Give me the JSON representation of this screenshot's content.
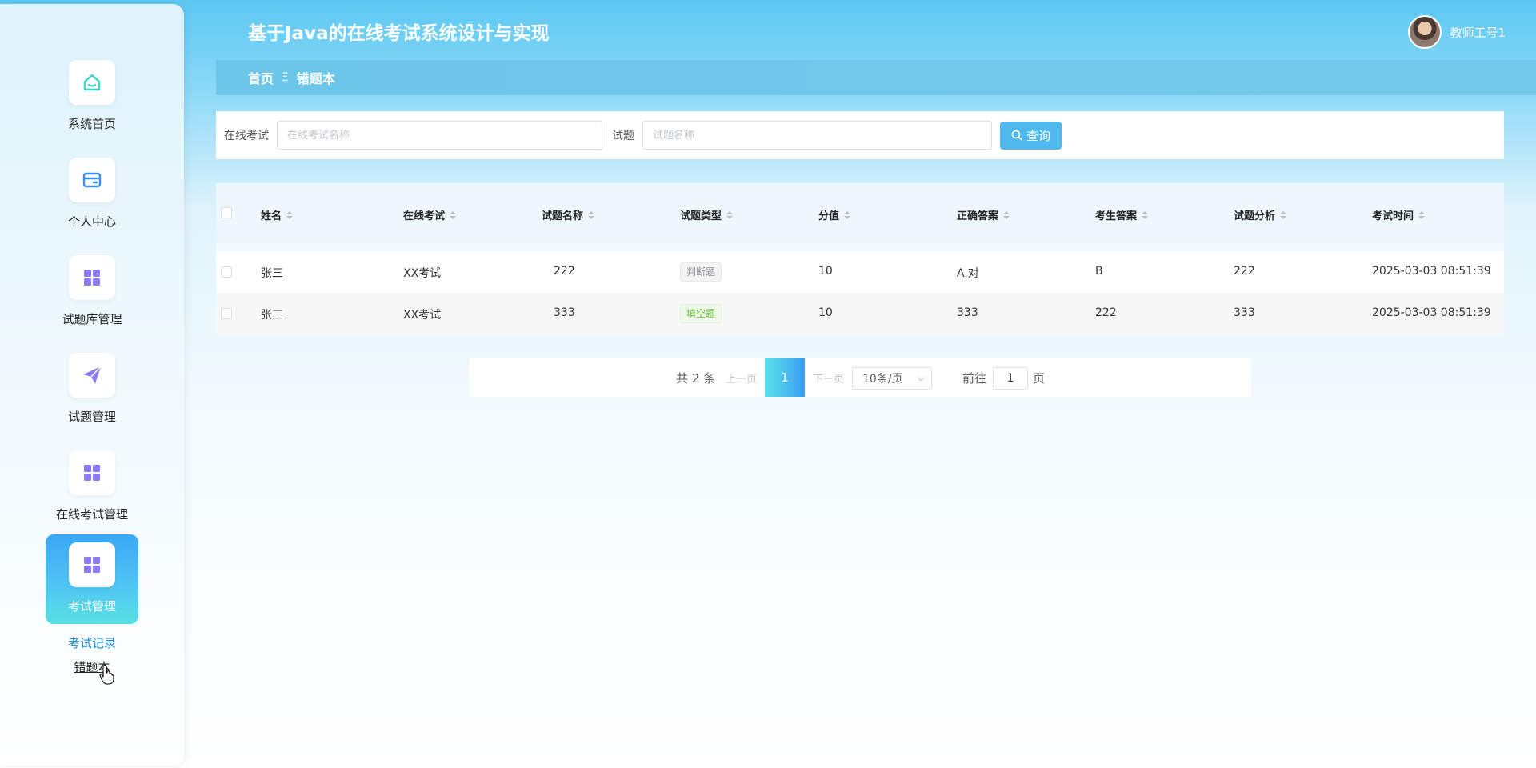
{
  "app": {
    "title": "基于Java的在线考试系统设计与实现"
  },
  "user": {
    "name": "教师工号1"
  },
  "sidebar": {
    "items": [
      {
        "label": "系统首页",
        "icon": "home-icon"
      },
      {
        "label": "个人中心",
        "icon": "wallet-card-icon"
      },
      {
        "label": "试题库管理",
        "icon": "grid-icon"
      },
      {
        "label": "试题管理",
        "icon": "paper-plane-icon"
      },
      {
        "label": "在线考试管理",
        "icon": "grid-icon"
      },
      {
        "label": "考试管理",
        "icon": "grid-icon",
        "active": true
      }
    ],
    "submenu": [
      {
        "label": "考试记录"
      },
      {
        "label": "错题本"
      }
    ]
  },
  "breadcrumb": {
    "home": "首页",
    "separator": "Ξ",
    "current": "错题本"
  },
  "search": {
    "exam_label": "在线考试",
    "exam_placeholder": "在线考试名称",
    "question_label": "试题",
    "question_placeholder": "试题名称",
    "button_label": "查询"
  },
  "table": {
    "columns": [
      "姓名",
      "在线考试",
      "试题名称",
      "试题类型",
      "分值",
      "正确答案",
      "考生答案",
      "试题分析",
      "考试时间"
    ],
    "rows": [
      {
        "name": "张三",
        "exam": "XX考试",
        "question": "222",
        "type": "判断题",
        "score": "10",
        "correct": "A.对",
        "answer": "B",
        "analysis": "222",
        "time": "2025-03-03 08:51:39"
      },
      {
        "name": "张三",
        "exam": "XX考试",
        "question": "333",
        "type": "填空题",
        "score": "10",
        "correct": "333",
        "answer": "222",
        "analysis": "333",
        "time": "2025-03-03 08:51:39"
      }
    ]
  },
  "pagination": {
    "total": "共 2 条",
    "prev": "上一页",
    "current": "1",
    "next": "下一页",
    "page_size": "10条/页",
    "goto_label": "前往",
    "goto_value": "1",
    "goto_unit": "页"
  },
  "colors": {
    "accent": "#4fb9ee",
    "active_gradient_start": "#3aa8f5",
    "active_gradient_end": "#57e0e2",
    "icon_home": "#3fd4c8",
    "icon_card": "#3a8ee6",
    "icon_grid": "#8b7cf6"
  }
}
